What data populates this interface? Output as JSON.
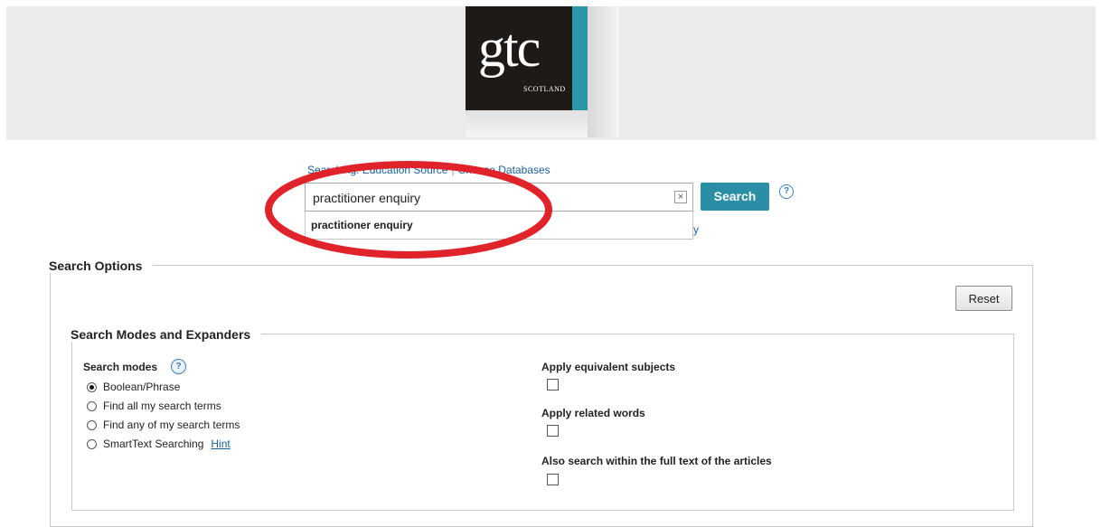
{
  "header": {
    "logo_text": "gtc",
    "logo_subtext": "SCOTLAND"
  },
  "search": {
    "searching_label": "Searching: Education Source",
    "separator": "|",
    "choose_databases": "Choose Databases",
    "query_value": "practitioner enquiry",
    "clear_symbol": "×",
    "search_button": "Search",
    "help_symbol": "?",
    "suggestion": "practitioner enquiry",
    "obscured_link_tail": "y"
  },
  "search_options": {
    "title": "Search Options",
    "reset_button": "Reset",
    "modes_section": {
      "title": "Search Modes and Expanders",
      "modes_label": "Search modes",
      "help_symbol": "?",
      "modes": [
        {
          "label": "Boolean/Phrase",
          "selected": true
        },
        {
          "label": "Find all my search terms",
          "selected": false
        },
        {
          "label": "Find any of my search terms",
          "selected": false
        },
        {
          "label": "SmartText Searching",
          "selected": false,
          "hint": "Hint"
        }
      ],
      "expanders": [
        {
          "label": "Apply equivalent subjects",
          "checked": false
        },
        {
          "label": "Apply related words",
          "checked": false
        },
        {
          "label": "Also search within the full text of the articles",
          "checked": false
        }
      ]
    }
  },
  "annotation": {
    "color": "#e0222a",
    "shape": "ellipse-highlight"
  },
  "colors": {
    "accent": "#2a8ea6",
    "link": "#1a5f97",
    "header_band": "#ebebea"
  }
}
